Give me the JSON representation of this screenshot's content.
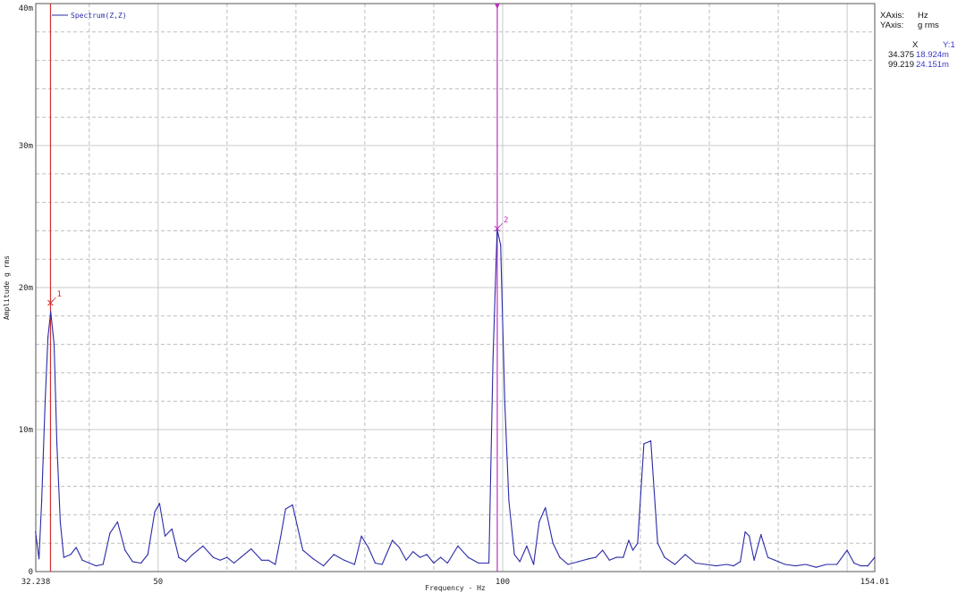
{
  "window": {
    "x_axis_label": "XAxis:",
    "x_axis_unit": "Hz",
    "y_axis_label": "YAxis:",
    "y_axis_unit": "g rms",
    "cursor_table": {
      "col_x": "X",
      "col_y": "Y:1",
      "rows": [
        {
          "x": "34.375",
          "y": "18.924m"
        },
        {
          "x": "99.219",
          "y": "24.151m"
        }
      ]
    }
  },
  "chart_data": {
    "type": "line",
    "xlabel": "Frequency - Hz",
    "ylabel": "Amplitude g rms",
    "xlim": [
      32.238,
      154.01
    ],
    "ylim": [
      0,
      40
    ],
    "x_tick_labels": [
      "32.238",
      "50",
      "100",
      "154.01"
    ],
    "x_ticks": [
      32.238,
      50,
      100,
      154.01
    ],
    "y_tick_labels": [
      "0",
      "10m",
      "20m",
      "30m",
      "40m"
    ],
    "y_ticks": [
      0,
      10,
      20,
      30,
      40
    ],
    "grid": true,
    "legend": "top-left",
    "series": [
      {
        "name": "Spectrum(Z,Z)",
        "color": "#2a2aa8",
        "x": [
          32.2,
          32.7,
          33.1,
          33.6,
          34.0,
          34.4,
          34.9,
          35.3,
          35.8,
          36.3,
          37.3,
          38.1,
          39.0,
          40.0,
          41.0,
          42.0,
          43.0,
          44.1,
          45.2,
          46.3,
          47.5,
          48.5,
          49.5,
          50.2,
          51.0,
          52.0,
          53.0,
          54.0,
          55.0,
          56.5,
          58.0,
          59.0,
          60.0,
          61.0,
          62.0,
          63.5,
          65.0,
          66.0,
          67.0,
          67.8,
          68.5,
          69.5,
          71.0,
          72.5,
          74.0,
          75.5,
          77.0,
          78.5,
          79.5,
          80.5,
          81.5,
          82.5,
          84.0,
          85.0,
          86.0,
          87.0,
          88.0,
          89.0,
          90.0,
          91.0,
          92.0,
          93.5,
          95.0,
          96.5,
          98.0,
          98.6,
          99.2,
          99.7,
          100.3,
          100.9,
          101.7,
          102.5,
          103.5,
          104.5,
          105.3,
          106.2,
          107.3,
          108.3,
          109.5,
          111.0,
          112.5,
          113.5,
          114.5,
          115.5,
          116.5,
          117.5,
          118.3,
          118.9,
          119.6,
          120.5,
          121.5,
          122.5,
          123.5,
          125.0,
          126.5,
          128.0,
          129.5,
          131.0,
          132.5,
          133.5,
          134.5,
          135.2,
          135.8,
          136.5,
          137.5,
          138.5,
          139.5,
          141.0,
          142.5,
          144.0,
          145.5,
          147.0,
          148.5,
          150.0,
          151.0,
          152.0,
          153.0,
          154.0
        ],
        "values": [
          2.8,
          0.9,
          5.0,
          12.0,
          16.5,
          18.3,
          16.0,
          9.0,
          3.5,
          1.0,
          1.2,
          1.7,
          0.8,
          0.6,
          0.4,
          0.5,
          2.7,
          3.5,
          1.5,
          0.7,
          0.6,
          1.2,
          4.2,
          4.8,
          2.5,
          3.0,
          1.0,
          0.7,
          1.2,
          1.8,
          1.0,
          0.8,
          1.0,
          0.6,
          1.0,
          1.6,
          0.8,
          0.8,
          0.5,
          2.5,
          4.4,
          4.7,
          1.5,
          0.9,
          0.4,
          1.2,
          0.8,
          0.5,
          2.5,
          1.7,
          0.6,
          0.5,
          2.2,
          1.7,
          0.8,
          1.4,
          1.0,
          1.2,
          0.6,
          1.0,
          0.6,
          1.8,
          1.0,
          0.6,
          0.6,
          15.0,
          24.1,
          23.0,
          12.0,
          5.0,
          1.2,
          0.7,
          1.8,
          0.5,
          3.5,
          4.5,
          2.0,
          1.0,
          0.5,
          0.7,
          0.9,
          1.0,
          1.5,
          0.8,
          1.0,
          1.0,
          2.2,
          1.5,
          2.0,
          9.0,
          9.2,
          2.0,
          1.0,
          0.5,
          1.2,
          0.6,
          0.5,
          0.4,
          0.5,
          0.4,
          0.7,
          2.8,
          2.5,
          0.8,
          2.6,
          1.0,
          0.8,
          0.5,
          0.4,
          0.5,
          0.3,
          0.5,
          0.5,
          1.5,
          0.6,
          0.4,
          0.4,
          1.0
        ]
      }
    ],
    "cursors": [
      {
        "label": "1",
        "x": 34.375,
        "y": 18.924,
        "color": "#d03030"
      },
      {
        "label": "2",
        "x": 99.219,
        "y": 24.151,
        "color": "#c030c0"
      }
    ]
  }
}
